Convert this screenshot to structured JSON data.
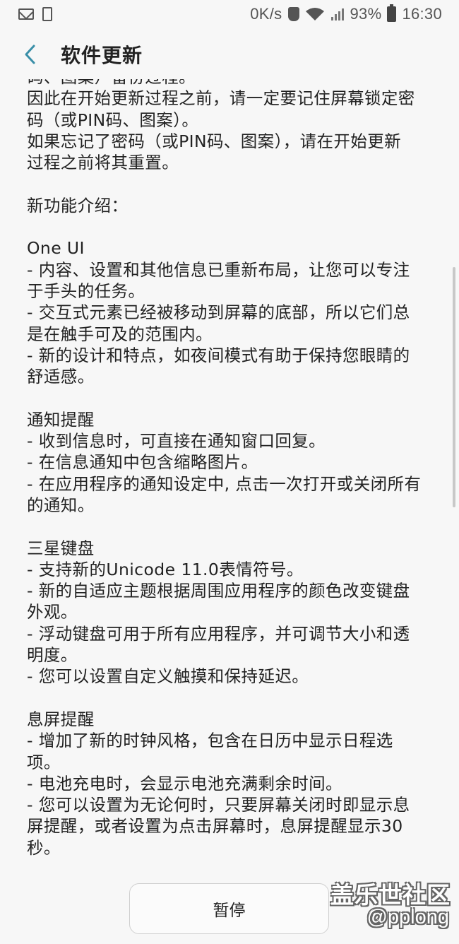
{
  "status_bar": {
    "speed": "0K/s",
    "battery_percent": "93%",
    "time": "16:30",
    "icons": [
      "mail-icon",
      "phone-icon",
      "shield-icon",
      "wifi-icon",
      "signal-icon",
      "battery-icon"
    ]
  },
  "app_bar": {
    "title": "软件更新",
    "back_icon": "chevron-left-icon"
  },
  "content": {
    "lines": [
      "码、图案）备份过程。",
      "因此在开始更新过程之前，请一定要记住屏幕锁定密",
      "码（或PIN码、图案）。",
      "如果忘记了密码（或PIN码、图案），请在开始更新",
      "过程之前将其重置。",
      "",
      "新功能介绍：",
      "",
      "One UI",
      "- 内容、设置和其他信息已重新布局，让您可以专注",
      "于手头的任务。",
      "- 交互式元素已经被移动到屏幕的底部，所以它们总",
      "是在触手可及的范围内。",
      "- 新的设计和特点，如夜间模式有助于保持您眼睛的",
      "舒适感。",
      "",
      "通知提醒",
      "- 收到信息时，可直接在通知窗口回复。",
      "- 在信息通知中包含缩略图片。",
      "- 在应用程序的通知设定中, 点击一次打开或关闭所有",
      "的通知。",
      "",
      "三星键盘",
      "- 支持新的Unicode 11.0表情符号。",
      "- 新的自适应主题根据周围应用程序的颜色改变键盘",
      "外观。",
      "- 浮动键盘可用于所有应用程序，并可调节大小和透",
      "明度。",
      "- 您可以设置自定义触摸和保持延迟。",
      "",
      "息屏提醒",
      "- 增加了新的时钟风格，包含在日历中显示日程选",
      "项。",
      "- 电池充电时，会显示电池充满剩余时间。",
      "- 您可以设置为无论何时，只要屏幕关闭时即显示息",
      "屏提醒，或者设置为点击屏幕时，息屏提醒显示30",
      "秒。"
    ]
  },
  "bottom_bar": {
    "pause_label": "暂停"
  },
  "watermark": {
    "line1": "盖乐世社区",
    "line2": "@pplong"
  }
}
